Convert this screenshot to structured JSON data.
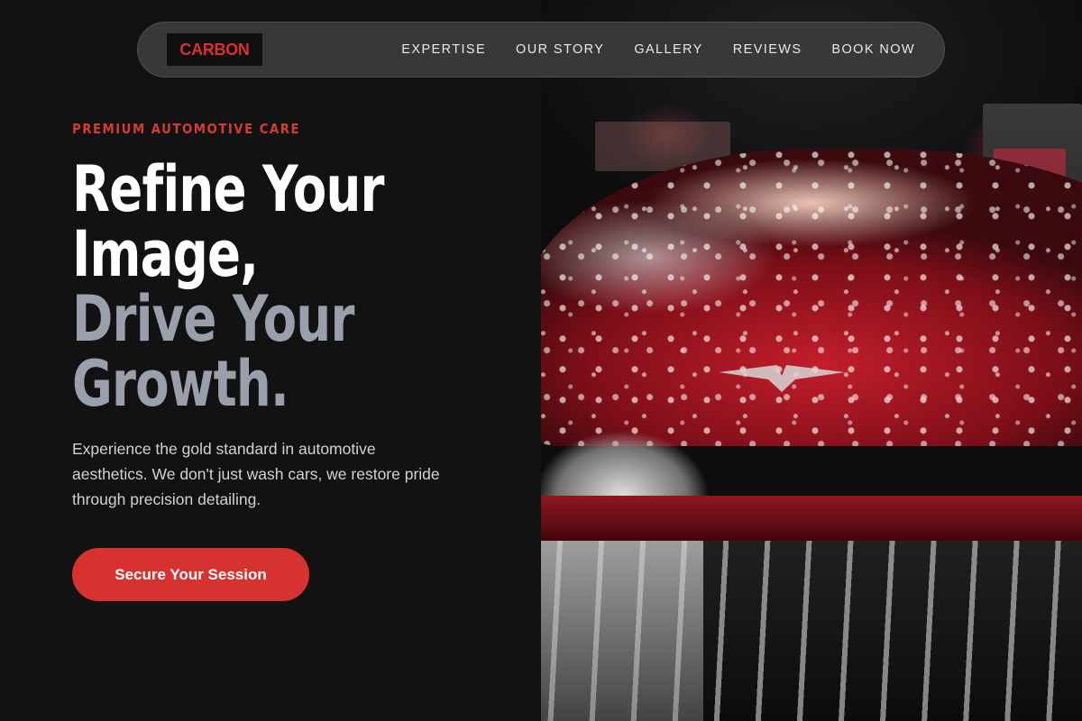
{
  "brand": {
    "logo_text": "CARBON",
    "accent": "#d9302f"
  },
  "nav": {
    "items": [
      {
        "label": "EXPERTISE"
      },
      {
        "label": "OUR STORY"
      },
      {
        "label": "GALLERY"
      },
      {
        "label": "REVIEWS"
      },
      {
        "label": "BOOK NOW"
      }
    ]
  },
  "hero": {
    "eyebrow": "PREMIUM AUTOMOTIVE CARE",
    "headline_lines": [
      "Refine Your",
      "Image,",
      "Drive Your",
      "Growth."
    ],
    "description": "Experience the gold standard in automotive aesthetics. We don't just wash cars, we restore pride through precision detailing.",
    "cta_label": "Secure Your Session",
    "colors": {
      "headline_primary": "#ffffff",
      "headline_secondary": "#9aa0ab",
      "button": "#d53230",
      "background": "#121213"
    }
  },
  "image": {
    "subject": "red sports car covered in wash foam"
  }
}
